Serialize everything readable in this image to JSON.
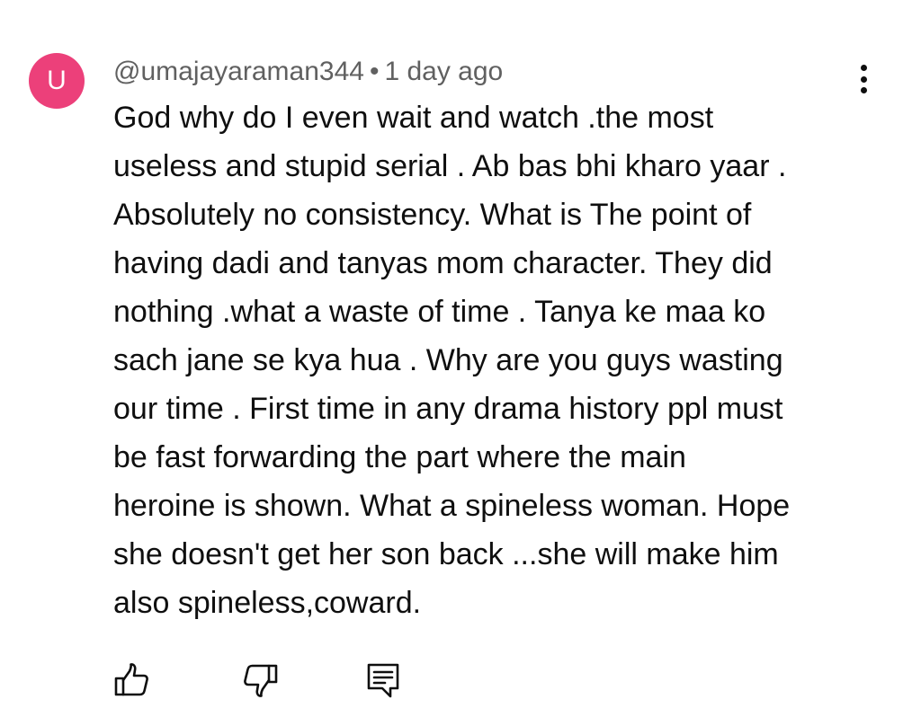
{
  "comment": {
    "avatar_letter": "U",
    "avatar_color": "#ec407a",
    "author": "@umajayaraman344",
    "separator": "•",
    "timestamp": "1 day ago",
    "text": "God why do I even wait and watch .the most\nuseless and stupid serial . Ab bas bhi kharo yaar .\nAbsolutely no consistency. What is The point of\nhaving dadi and tanyas mom character. They did\nnothing .what a waste of time . Tanya ke maa ko\nsach jane se kya hua .  Why are you guys wasting\nour time . First time in any drama history ppl must\nbe fast  forwarding the part where the main\nheroine is shown. What a spineless woman. Hope\nshe doesn't get her son back ...she will make him\nalso spineless,coward.",
    "actions": {
      "like_icon": "thumbs-up-icon",
      "dislike_icon": "thumbs-down-icon",
      "reply_icon": "reply-comment-icon"
    },
    "menu_icon": "more-vertical-icon"
  }
}
